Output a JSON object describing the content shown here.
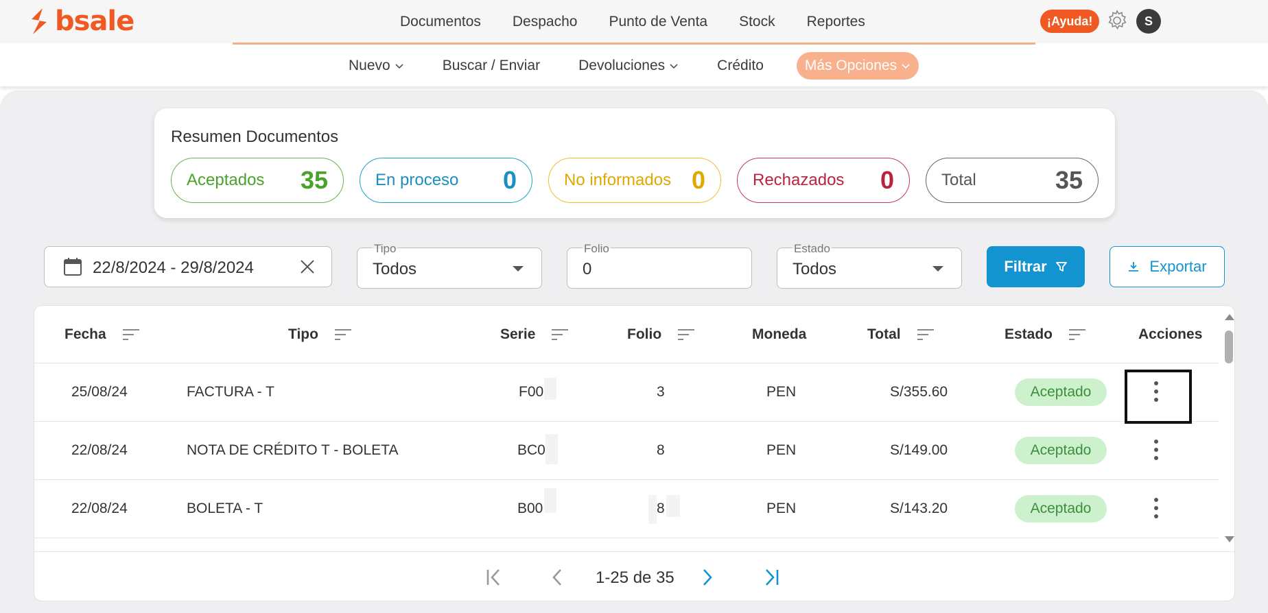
{
  "app": {
    "logo_text": "bsale",
    "brand_color": "#f05a22"
  },
  "main_nav": [
    "Documentos",
    "Despacho",
    "Punto de Venta",
    "Stock",
    "Reportes"
  ],
  "help_label": "¡Ayuda!",
  "user_initial": "S",
  "sub_nav": {
    "nuevo": "Nuevo",
    "buscar": "Buscar / Enviar",
    "devoluciones": "Devoluciones",
    "credito": "Crédito",
    "mas": "Más Opciones"
  },
  "summary": {
    "title": "Resumen Documentos",
    "chips": [
      {
        "label": "Aceptados",
        "value": "35",
        "color": "#4aa22b"
      },
      {
        "label": "En proceso",
        "value": "0",
        "color": "#1a8fc2"
      },
      {
        "label": "No informados",
        "value": "0",
        "color": "#e0a800"
      },
      {
        "label": "Rechazados",
        "value": "0",
        "color": "#b8243f"
      },
      {
        "label": "Total",
        "value": "35",
        "color": "#555555"
      }
    ]
  },
  "filters": {
    "date_range": "22/8/2024 - 29/8/2024",
    "tipo_label": "Tipo",
    "tipo_value": "Todos",
    "folio_label": "Folio",
    "folio_value": "0",
    "estado_label": "Estado",
    "estado_value": "Todos",
    "filtrar": "Filtrar",
    "exportar": "Exportar"
  },
  "table": {
    "headers": {
      "fecha": "Fecha",
      "tipo": "Tipo",
      "serie": "Serie",
      "folio": "Folio",
      "moneda": "Moneda",
      "total": "Total",
      "estado": "Estado",
      "acciones": "Acciones"
    },
    "rows": [
      {
        "fecha": "25/08/24",
        "tipo": "FACTURA - T",
        "serie": "F00",
        "folio": "3",
        "moneda": "PEN",
        "total": "S/355.60",
        "estado": "Aceptado"
      },
      {
        "fecha": "22/08/24",
        "tipo": "NOTA DE CRÉDITO T - BOLETA",
        "serie": "BC0",
        "folio": "8",
        "moneda": "PEN",
        "total": "S/149.00",
        "estado": "Aceptado"
      },
      {
        "fecha": "22/08/24",
        "tipo": "BOLETA - T",
        "serie": "B00",
        "folio": "8",
        "moneda": "PEN",
        "total": "S/143.20",
        "estado": "Aceptado"
      }
    ]
  },
  "pagination": {
    "range_text": "1-25 de 35"
  }
}
